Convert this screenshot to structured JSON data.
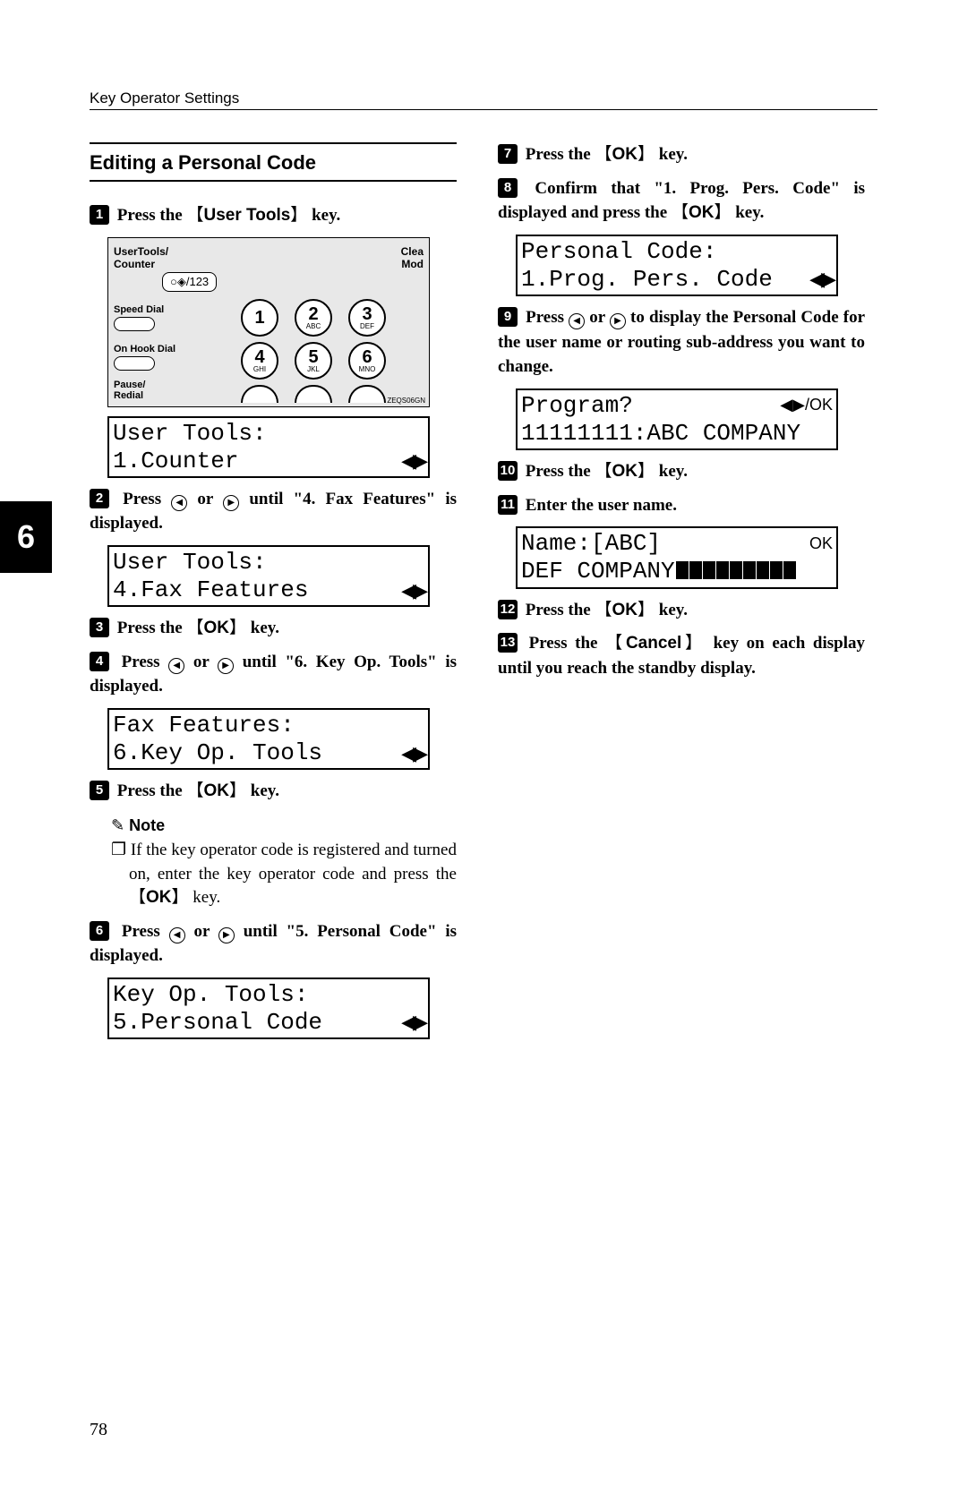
{
  "header": {
    "running": "Key Operator Settings"
  },
  "tab": "6",
  "page_number": "78",
  "section_title": "Editing a Personal Code",
  "keys": {
    "user_tools": "User Tools",
    "ok": "OK",
    "cancel": "Cancel"
  },
  "steps": {
    "s1": {
      "n": "1",
      "pre": "Press the ",
      "post": " key."
    },
    "s2": {
      "n": "2",
      "pre": "Press ",
      "mid": " or ",
      "post": " until \"4. Fax Features\" is displayed."
    },
    "s3": {
      "n": "3",
      "pre": "Press the ",
      "post": " key."
    },
    "s4": {
      "n": "4",
      "pre": "Press ",
      "mid": " or ",
      "post": " until \"6. Key Op. Tools\" is displayed."
    },
    "s5": {
      "n": "5",
      "pre": "Press the ",
      "post": " key."
    },
    "s6": {
      "n": "6",
      "pre": "Press ",
      "mid": " or ",
      "post": " until \"5. Personal Code\" is displayed."
    },
    "s7": {
      "n": "7",
      "pre": "Press the ",
      "post": " key."
    },
    "s8": {
      "n": "8",
      "pre": "Confirm that \"1. Prog. Pers. Code\" is displayed and press the ",
      "post": " key."
    },
    "s9": {
      "n": "9",
      "pre": "Press ",
      "mid": " or ",
      "post": " to display the Personal Code for the user name or routing sub-address you want to change."
    },
    "s10": {
      "n": "10",
      "pre": "Press the ",
      "post": " key."
    },
    "s11": {
      "n": "11",
      "text": "Enter the user name."
    },
    "s12": {
      "n": "12",
      "pre": "Press the ",
      "post": " key."
    },
    "s13": {
      "n": "13",
      "pre": "Press the ",
      "post": " key on each display until you reach the standby display."
    }
  },
  "note": {
    "heading": "Note",
    "body_a": "If the key operator code is registered and turned on, enter the key operator code and press the ",
    "body_b": " key."
  },
  "lcd": {
    "d1": {
      "l1": "User Tools:",
      "l2": "1.Counter",
      "nav": "◀▶"
    },
    "d2": {
      "l1": "User Tools:",
      "l2": "4.Fax Features",
      "nav": "◀▶"
    },
    "d3": {
      "l1": "Fax Features:",
      "l2": "6.Key Op. Tools",
      "nav": "◀▶"
    },
    "d4": {
      "l1": "Key Op. Tools:",
      "l2": "5.Personal Code",
      "nav": "◀▶"
    },
    "d5": {
      "l1": "Personal Code:",
      "l2": "1.Prog. Pers. Code",
      "nav": "◀▶"
    },
    "d6": {
      "l1": "Program?",
      "r1": "◀▶/OK",
      "l2": "11111111:ABC COMPANY"
    },
    "d7": {
      "l1": "Name:[ABC]",
      "r1": "OK",
      "l2": "DEF COMPANY"
    }
  },
  "keypad": {
    "top_left": "UserTools/\nCounter",
    "top_right": "Clea\nMod",
    "button_glyph": "○◈/123",
    "speed_dial": "Speed Dial",
    "on_hook": "On Hook Dial",
    "pause": "Pause/\nRedial",
    "keys": [
      {
        "n": "1",
        "s": ""
      },
      {
        "n": "2",
        "s": "ABC"
      },
      {
        "n": "3",
        "s": "DEF"
      },
      {
        "n": "4",
        "s": "GHI"
      },
      {
        "n": "5",
        "s": "JKL"
      },
      {
        "n": "6",
        "s": "MNO"
      }
    ],
    "code": "ZEQS06GN"
  }
}
